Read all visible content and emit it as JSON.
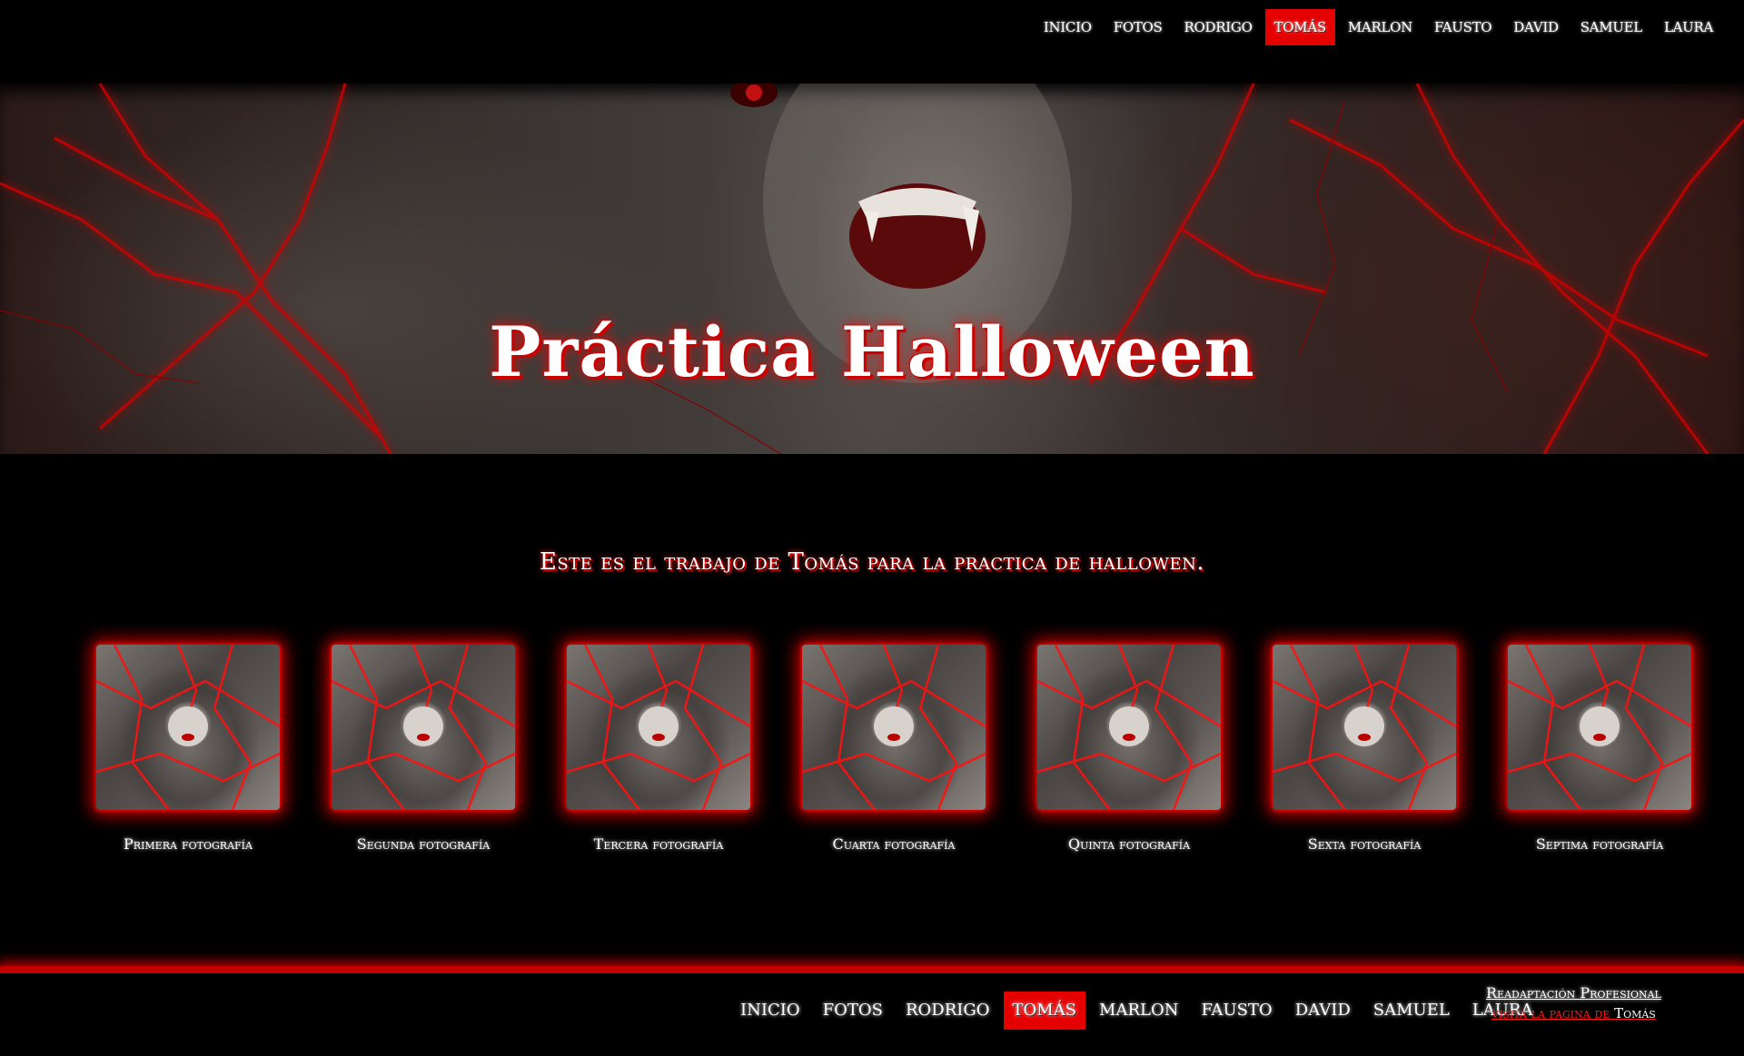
{
  "nav": {
    "items": [
      "INICIO",
      "FOTOS",
      "RODRIGO",
      "TOMÁS",
      "MARLON",
      "FAUSTO",
      "DAVID",
      "SAMUEL",
      "LAURA"
    ],
    "active": "TOMÁS"
  },
  "hero": {
    "title": "Práctica Halloween"
  },
  "intro": {
    "text": "Este es el trabajo de Tomás para la practica de hallowen."
  },
  "gallery": {
    "captions": [
      "Primera fotografía",
      "Segunda fotografía",
      "Tercera fotografía",
      "Cuarta fotografía",
      "Quinta fotografía",
      "Sexta fotografía",
      "Septima fotografía"
    ]
  },
  "footer": {
    "nav": [
      "INICIO",
      "FOTOS",
      "RODRIGO",
      "TOMÁS",
      "MARLON",
      "FAUSTO",
      "DAVID",
      "SAMUEL",
      "LAURA"
    ],
    "credit_title": "Readaptación Profesional",
    "credit_link_prefix": "visita la pagina de ",
    "credit_link_name": "Tomás"
  },
  "colors": {
    "accent": "#e50000",
    "glow": "#ff0000",
    "background": "#000000"
  }
}
